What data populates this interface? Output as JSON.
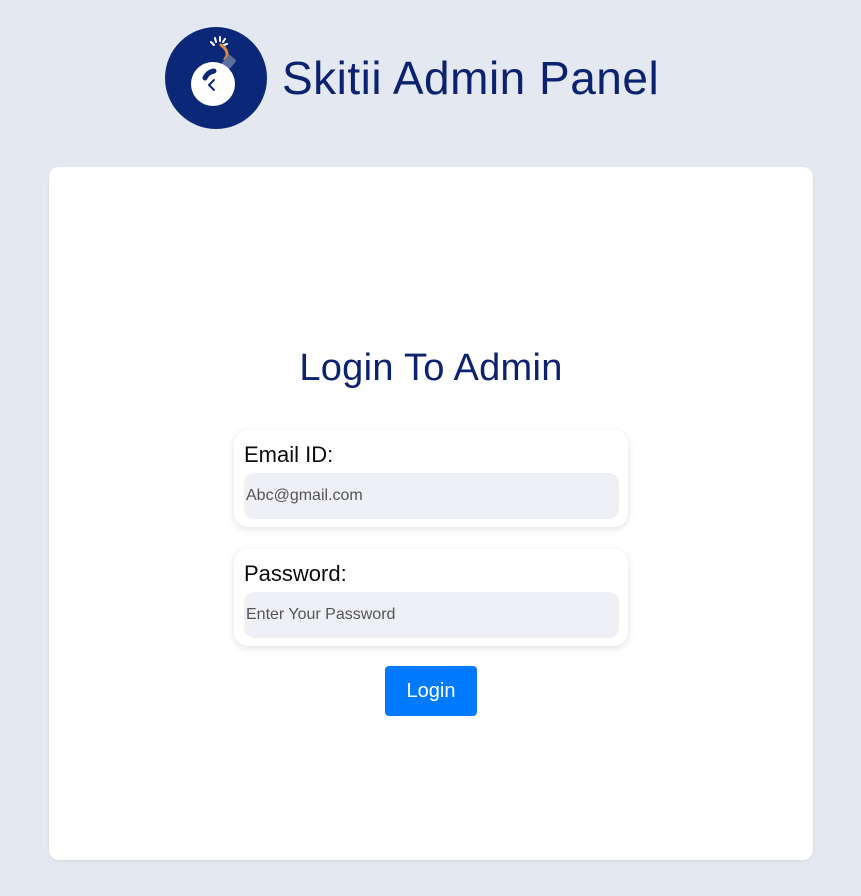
{
  "header": {
    "title": "Skitii Admin Panel",
    "logo_icon": "stopwatch-bomb-icon"
  },
  "login": {
    "title": "Login To Admin",
    "email_label": "Email ID:",
    "email_placeholder": "Abc@gmail.com",
    "password_label": "Password:",
    "password_placeholder": "Enter Your Password",
    "button_label": "Login"
  },
  "colors": {
    "background": "#e4e8f1",
    "brand_navy": "#0b2270",
    "logo_circle": "#0b2878",
    "button": "#007bff",
    "input_fill": "#eef0f5"
  }
}
